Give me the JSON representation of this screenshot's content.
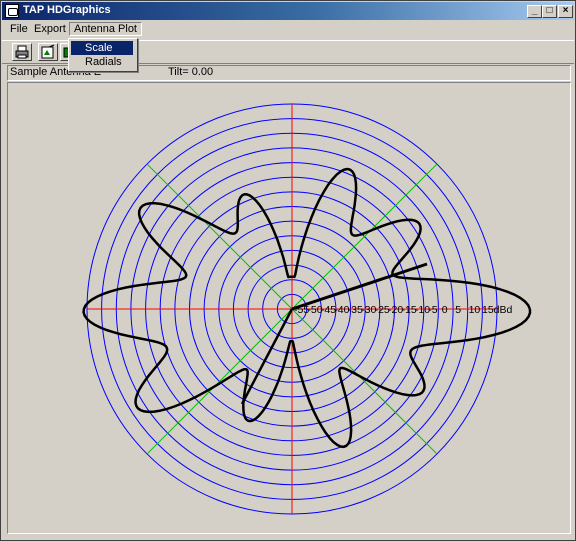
{
  "window": {
    "title": "TAP HDGraphics"
  },
  "menu": {
    "file": "File",
    "export": "Export",
    "antenna_plot": "Antenna Plot"
  },
  "dropdown": {
    "items": [
      "Scale",
      "Radials"
    ],
    "selected": "Scale"
  },
  "info": {
    "left_text": "Sample Antenna E",
    "right_text": "Tilt= 0.00"
  },
  "plot": {
    "unit": "dBd",
    "scale_labels": [
      "-55",
      "-50",
      "-45",
      "-40",
      "-35",
      "-30",
      "-25",
      "-20",
      "-15",
      "-10",
      "-5",
      "0",
      "5",
      "10",
      "15dBd"
    ],
    "colors": {
      "rings": "#0000ff",
      "axes": "#ff0000",
      "diagonals": "#00c000",
      "pattern": "#000000"
    }
  }
}
